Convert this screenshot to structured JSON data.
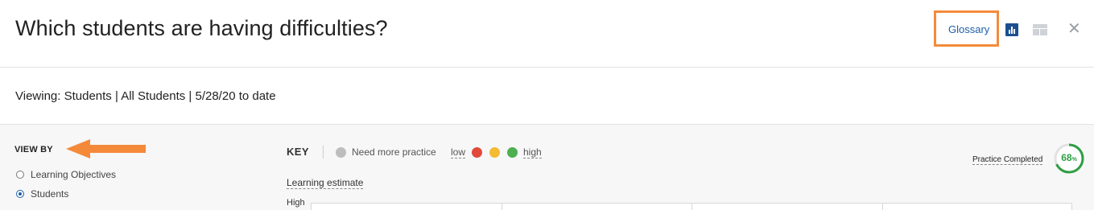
{
  "header": {
    "title": "Which students are having difficulties?",
    "glossary_label": "Glossary",
    "chart_view_icon": "bar-chart-icon",
    "table_view_icon": "table-icon",
    "close_icon": "close-icon",
    "close_glyph": "✕"
  },
  "viewing": {
    "text": "Viewing: Students | All Students | 5/28/20 to date"
  },
  "view_by": {
    "title": "VIEW BY",
    "options": [
      {
        "label": "Learning Objectives",
        "selected": false
      },
      {
        "label": "Students",
        "selected": true
      }
    ]
  },
  "key": {
    "label": "KEY",
    "need_more_practice": "Need more practice",
    "low": "low",
    "high": "high",
    "colors": {
      "need_more_practice": "#bdbdbd",
      "low": "#e04a3a",
      "mid": "#f3bb33",
      "high": "#4caf50"
    }
  },
  "plot": {
    "estimate_label": "Learning estimate",
    "high_label": "High"
  },
  "practice": {
    "label": "Practice Completed",
    "value": 68,
    "value_text": "68",
    "unit": "%",
    "color": "#2e9e43"
  },
  "annotations": {
    "highlight_color": "#f58b3b"
  }
}
